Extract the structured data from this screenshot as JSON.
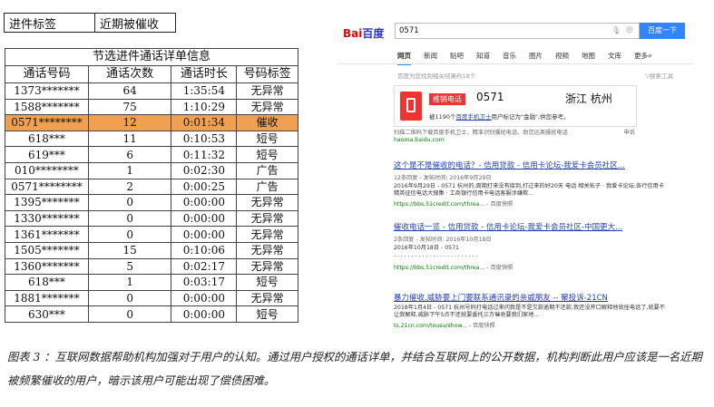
{
  "tag_box": {
    "label": "进件标签",
    "value": "近期被催收"
  },
  "table": {
    "title": "节选进件通话详单信息",
    "headers": [
      "通话号码",
      "通话次数",
      "通话时长",
      "号码标签"
    ],
    "rows": [
      [
        "1373*******",
        "64",
        "1:35:54",
        "无异常"
      ],
      [
        "1588*******",
        "75",
        "1:10:29",
        "无异常"
      ],
      [
        "0571********",
        "12",
        "0:01:34",
        "催收"
      ],
      [
        "618***",
        "11",
        "0:10:53",
        "短号"
      ],
      [
        "619***",
        "6",
        "0:11:32",
        "短号"
      ],
      [
        "010********",
        "1",
        "0:02:30",
        "广告"
      ],
      [
        "0571********",
        "2",
        "0:00:25",
        "广告"
      ],
      [
        "1395*******",
        "0",
        "0:00:00",
        "无异常"
      ],
      [
        "1330*******",
        "0",
        "0:00:00",
        "无异常"
      ],
      [
        "1361*******",
        "0",
        "0:00:00",
        "无异常"
      ],
      [
        "1505*******",
        "15",
        "0:10:06",
        "无异常"
      ],
      [
        "1360*******",
        "5",
        "0:02:17",
        "无异常"
      ],
      [
        "618***",
        "1",
        "0:03:17",
        "短号"
      ],
      [
        "1881*******",
        "0",
        "0:00:00",
        "无异常"
      ],
      [
        "630***",
        "0",
        "0:00:00",
        "短号"
      ]
    ],
    "highlight_row": 2,
    "highlight_color": "#f0a050"
  },
  "caption": "图表 3 ：互联网数据帮助机构加强对于用户的认知。通过用户授权的通话详单，并结合互联网上的公开数据，机构判断此用户应该是一名近期被频繁催收的用户，暗示该用户可能出现了偿债困难。",
  "baidu": {
    "logo_bai": "Bai",
    "logo_du": "百度",
    "search_value": "0571",
    "search_button": "百度一下",
    "tabs": [
      "网页",
      "新闻",
      "贴吧",
      "知道",
      "音乐",
      "图片",
      "视频",
      "地图",
      "文库",
      "更多»"
    ],
    "result_count": "百度为您找到相关结果约18个",
    "search_tools": "搜索工具",
    "card": {
      "badge": "推销电话",
      "number": "0571",
      "location": "浙江 杭州",
      "desc_pre": "被1190个",
      "desc_link": "百度手机卫士",
      "desc_post": "用户标记为\"金融\",供您参考。",
      "foot_left": "扫描二维码下载百度手机卫士，精准识别骚扰电话、助您远离骚扰电话",
      "foot_right": "申诉",
      "source": "haoma.baidu.com"
    },
    "results": [
      {
        "title": "这个是不是催收的电话？- 信用贷款 - 信用卡论坛-我爱卡会员社区...",
        "meta": "12条回复 - 发帖时间: 2016年9月29日",
        "desc": "2016年9月29日 - 0571 杭州的,周期打来没有接到,打过来的好20天 电话 相关帖子 · 我爱卡论坛:各行信用卡精英征信电话大搜集 · 工商银行信用卡电话客服涉嫌欺...",
        "url": "https://bbs.51credit.com/threa...",
        "snapshot": "百度快照"
      },
      {
        "title": "催收电话一览 - 信用贷款 - 信用卡论坛-我爱卡会员社区-中国更大...",
        "meta": "2条回复 - 发帖时间: 2016年10月18日",
        "desc": "2016年10月18日 - 0571",
        "url": "https://bbs.51credit.com/threa...",
        "snapshot": "百度快照"
      },
      {
        "title": "暴力催收,威胁要上门要联系通讯录的亲戚朋友 -- 聚投诉-21CN",
        "meta": "",
        "desc": "2018年1月4日 - 0571 杭州号码打电话过来问我是不是欠款逾期不还款,我还没开口解释他就挂电话了,就要不让我解释,威胁下午5点不还就要委托三方催收要我们家地...",
        "url": "ts.21cn.com/tousu/show...",
        "snapshot": "百度快照"
      }
    ]
  }
}
